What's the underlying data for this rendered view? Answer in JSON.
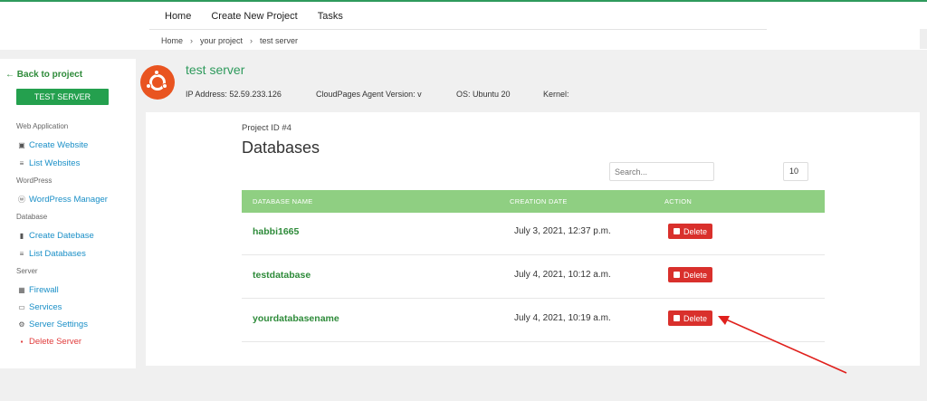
{
  "topnav": {
    "items": [
      "Home",
      "Create New Project",
      "Tasks"
    ]
  },
  "breadcrumb": {
    "items": [
      "Home",
      "your project",
      "test server"
    ],
    "separator": "›"
  },
  "sidebar": {
    "back_label": "Back to project",
    "server_button": "TEST SERVER",
    "sections": [
      {
        "title": "Web Application",
        "items": [
          {
            "label": "Create Website",
            "icon": "website-icon"
          },
          {
            "label": "List Websites",
            "icon": "list-icon"
          }
        ]
      },
      {
        "title": "WordPress",
        "items": [
          {
            "label": "WordPress Manager",
            "icon": "wordpress-icon"
          }
        ]
      },
      {
        "title": "Database",
        "items": [
          {
            "label": "Create Datebase",
            "icon": "database-icon"
          },
          {
            "label": "List Databases",
            "icon": "list-icon"
          }
        ]
      },
      {
        "title": "Server",
        "items": [
          {
            "label": "Firewall",
            "icon": "firewall-icon"
          },
          {
            "label": "Services",
            "icon": "services-icon"
          },
          {
            "label": "Server Settings",
            "icon": "gear-icon"
          },
          {
            "label": "Delete Server",
            "icon": "trash-icon"
          }
        ]
      }
    ]
  },
  "server": {
    "title": "test server",
    "ip": "IP Address: 52.59.233.126",
    "agent": "CloudPages Agent Version: v",
    "os": "OS: Ubuntu 20",
    "kernel": "Kernel:"
  },
  "main": {
    "project_id": "Project ID #4",
    "title": "Databases",
    "search_placeholder": "Search...",
    "per_page": "10",
    "columns": [
      "DATABASE NAME",
      "CREATION DATE",
      "ACTION"
    ],
    "rows": [
      {
        "name": "habbi1665",
        "date": "July 3, 2021, 12:37 p.m.",
        "action": "Delete"
      },
      {
        "name": "testdatabase",
        "date": "July 4, 2021, 10:12 a.m.",
        "action": "Delete"
      },
      {
        "name": "yourdatabasename",
        "date": "July 4, 2021, 10:19 a.m.",
        "action": "Delete"
      }
    ]
  },
  "colors": {
    "accent": "#2e9a5c",
    "header": "#8fcf82",
    "danger": "#d9302c",
    "link": "#1a8fc7",
    "annotation": "#e0201c"
  }
}
